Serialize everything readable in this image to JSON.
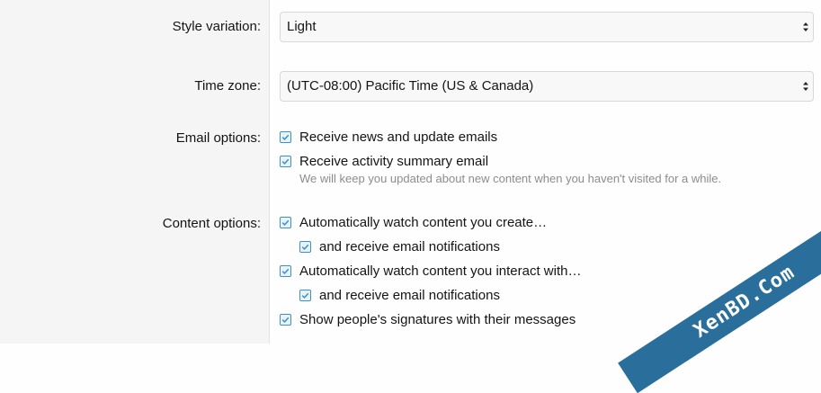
{
  "style_variation": {
    "label": "Style variation:",
    "value": "Light"
  },
  "time_zone": {
    "label": "Time zone:",
    "value": "(UTC-08:00) Pacific Time (US & Canada)"
  },
  "email_options": {
    "label": "Email options:",
    "items": [
      {
        "text": "Receive news and update emails",
        "checked": true
      },
      {
        "text": "Receive activity summary email",
        "checked": true
      }
    ],
    "hint": "We will keep you updated about new content when you haven't visited for a while."
  },
  "content_options": {
    "label": "Content options:",
    "items": [
      {
        "text": "Automatically watch content you create…",
        "checked": true
      },
      {
        "text": "and receive email notifications",
        "checked": true
      },
      {
        "text": "Automatically watch content you interact with…",
        "checked": true
      },
      {
        "text": "and receive email notifications",
        "checked": true
      },
      {
        "text": "Show people's signatures with their messages",
        "checked": true
      }
    ]
  },
  "watermark": "XenBD.Com",
  "colors": {
    "checkbox_accent": "#3f8fc8",
    "watermark_bg": "#2a6f9b"
  }
}
